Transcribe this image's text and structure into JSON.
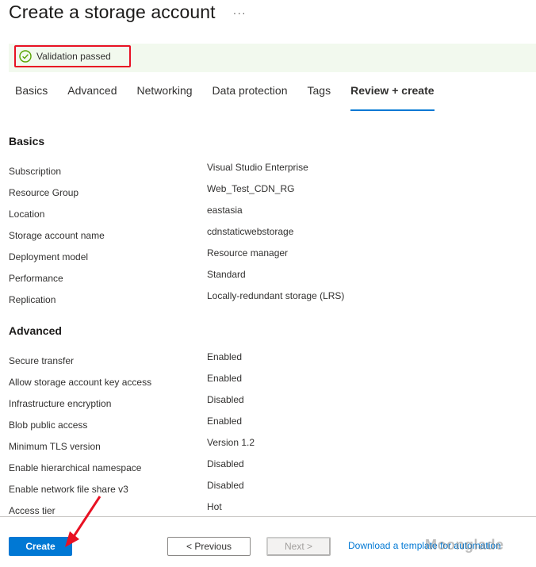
{
  "header": {
    "title": "Create a storage account",
    "more": "···"
  },
  "validation": {
    "text": "Validation passed",
    "icon": "check-circle-icon",
    "color": "#57a300"
  },
  "tabs": [
    {
      "label": "Basics"
    },
    {
      "label": "Advanced"
    },
    {
      "label": "Networking"
    },
    {
      "label": "Data protection"
    },
    {
      "label": "Tags"
    },
    {
      "label": "Review + create",
      "active": true
    }
  ],
  "basics": {
    "title": "Basics",
    "rows": [
      {
        "label": "Subscription",
        "value": "Visual Studio Enterprise"
      },
      {
        "label": "Resource Group",
        "value": "Web_Test_CDN_RG"
      },
      {
        "label": "Location",
        "value": "eastasia"
      },
      {
        "label": "Storage account name",
        "value": "cdnstaticwebstorage"
      },
      {
        "label": "Deployment model",
        "value": "Resource manager"
      },
      {
        "label": "Performance",
        "value": "Standard"
      },
      {
        "label": "Replication",
        "value": "Locally-redundant storage (LRS)"
      }
    ]
  },
  "advanced": {
    "title": "Advanced",
    "rows": [
      {
        "label": "Secure transfer",
        "value": "Enabled"
      },
      {
        "label": "Allow storage account key access",
        "value": "Enabled"
      },
      {
        "label": "Infrastructure encryption",
        "value": "Disabled"
      },
      {
        "label": "Blob public access",
        "value": "Enabled"
      },
      {
        "label": "Minimum TLS version",
        "value": "Version 1.2"
      },
      {
        "label": "Enable hierarchical namespace",
        "value": "Disabled"
      },
      {
        "label": "Enable network file share v3",
        "value": "Disabled"
      },
      {
        "label": "Access tier",
        "value": "Hot"
      }
    ]
  },
  "footer": {
    "create": "Create",
    "previous": "< Previous",
    "next": "Next >",
    "download": "Download a template for automation"
  },
  "watermark": "Moonglade",
  "colors": {
    "accent": "#0078d4",
    "highlight": "#e81123",
    "success": "#57a300"
  }
}
